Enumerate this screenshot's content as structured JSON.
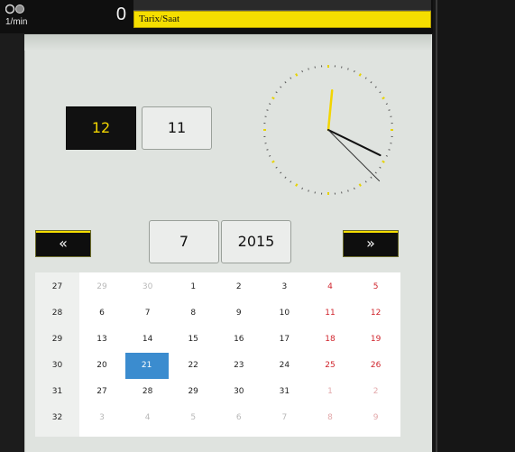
{
  "status": {
    "spindle_icon": "spindle-speed-icon",
    "unit": "1/min",
    "speed_value": "0"
  },
  "header": {
    "title": "Tarix/Saat"
  },
  "time": {
    "hour": "12",
    "minute": "11"
  },
  "clock": {
    "hours": 12,
    "minutes": 11,
    "seconds": 20,
    "hand_color": "#f2d500"
  },
  "date_nav": {
    "prev_label": "«",
    "next_label": "»",
    "month": "7",
    "year": "2015"
  },
  "calendar": {
    "weeks": [
      {
        "week": "27",
        "days": [
          "29",
          "30",
          "1",
          "2",
          "3",
          "4",
          "5"
        ],
        "types": [
          "o",
          "o",
          "c",
          "c",
          "c",
          "cw",
          "cw"
        ]
      },
      {
        "week": "28",
        "days": [
          "6",
          "7",
          "8",
          "9",
          "10",
          "11",
          "12"
        ],
        "types": [
          "c",
          "c",
          "c",
          "c",
          "c",
          "cw",
          "cw"
        ]
      },
      {
        "week": "29",
        "days": [
          "13",
          "14",
          "15",
          "16",
          "17",
          "18",
          "19"
        ],
        "types": [
          "c",
          "c",
          "c",
          "c",
          "c",
          "cw",
          "cw"
        ]
      },
      {
        "week": "30",
        "days": [
          "20",
          "21",
          "22",
          "23",
          "24",
          "25",
          "26"
        ],
        "types": [
          "c",
          "s",
          "c",
          "c",
          "c",
          "cw",
          "cw"
        ]
      },
      {
        "week": "31",
        "days": [
          "27",
          "28",
          "29",
          "30",
          "31",
          "1",
          "2"
        ],
        "types": [
          "c",
          "c",
          "c",
          "c",
          "c",
          "ow",
          "ow"
        ]
      },
      {
        "week": "32",
        "days": [
          "3",
          "4",
          "5",
          "6",
          "7",
          "8",
          "9"
        ],
        "types": [
          "o",
          "o",
          "o",
          "o",
          "o",
          "ow",
          "ow"
        ]
      }
    ],
    "selected_color": "#3b8ccf",
    "weekend_color": "#d0242c"
  }
}
